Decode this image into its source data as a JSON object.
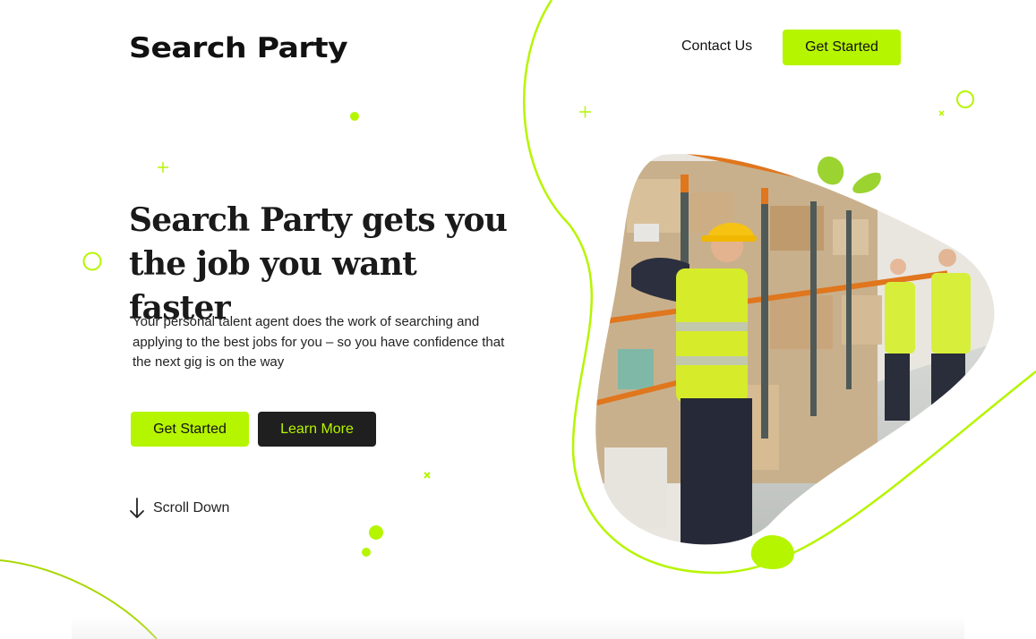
{
  "brand": {
    "name": "Search Party"
  },
  "nav": {
    "contact_label": "Contact Us",
    "cta_label": "Get Started"
  },
  "hero": {
    "title": "Search Party gets you the job you want faster",
    "description": "Your personal talent agent does the work of searching and applying to the best jobs for you – so you have confidence that the next gig is on the way",
    "primary_cta": "Get Started",
    "secondary_cta": "Learn More",
    "scroll_label": "Scroll Down"
  },
  "colors": {
    "accent": "#b6f500",
    "dark": "#1f1f1f",
    "text": "#1a1a1a"
  },
  "icons": {
    "scroll": "arrow-down-icon"
  }
}
